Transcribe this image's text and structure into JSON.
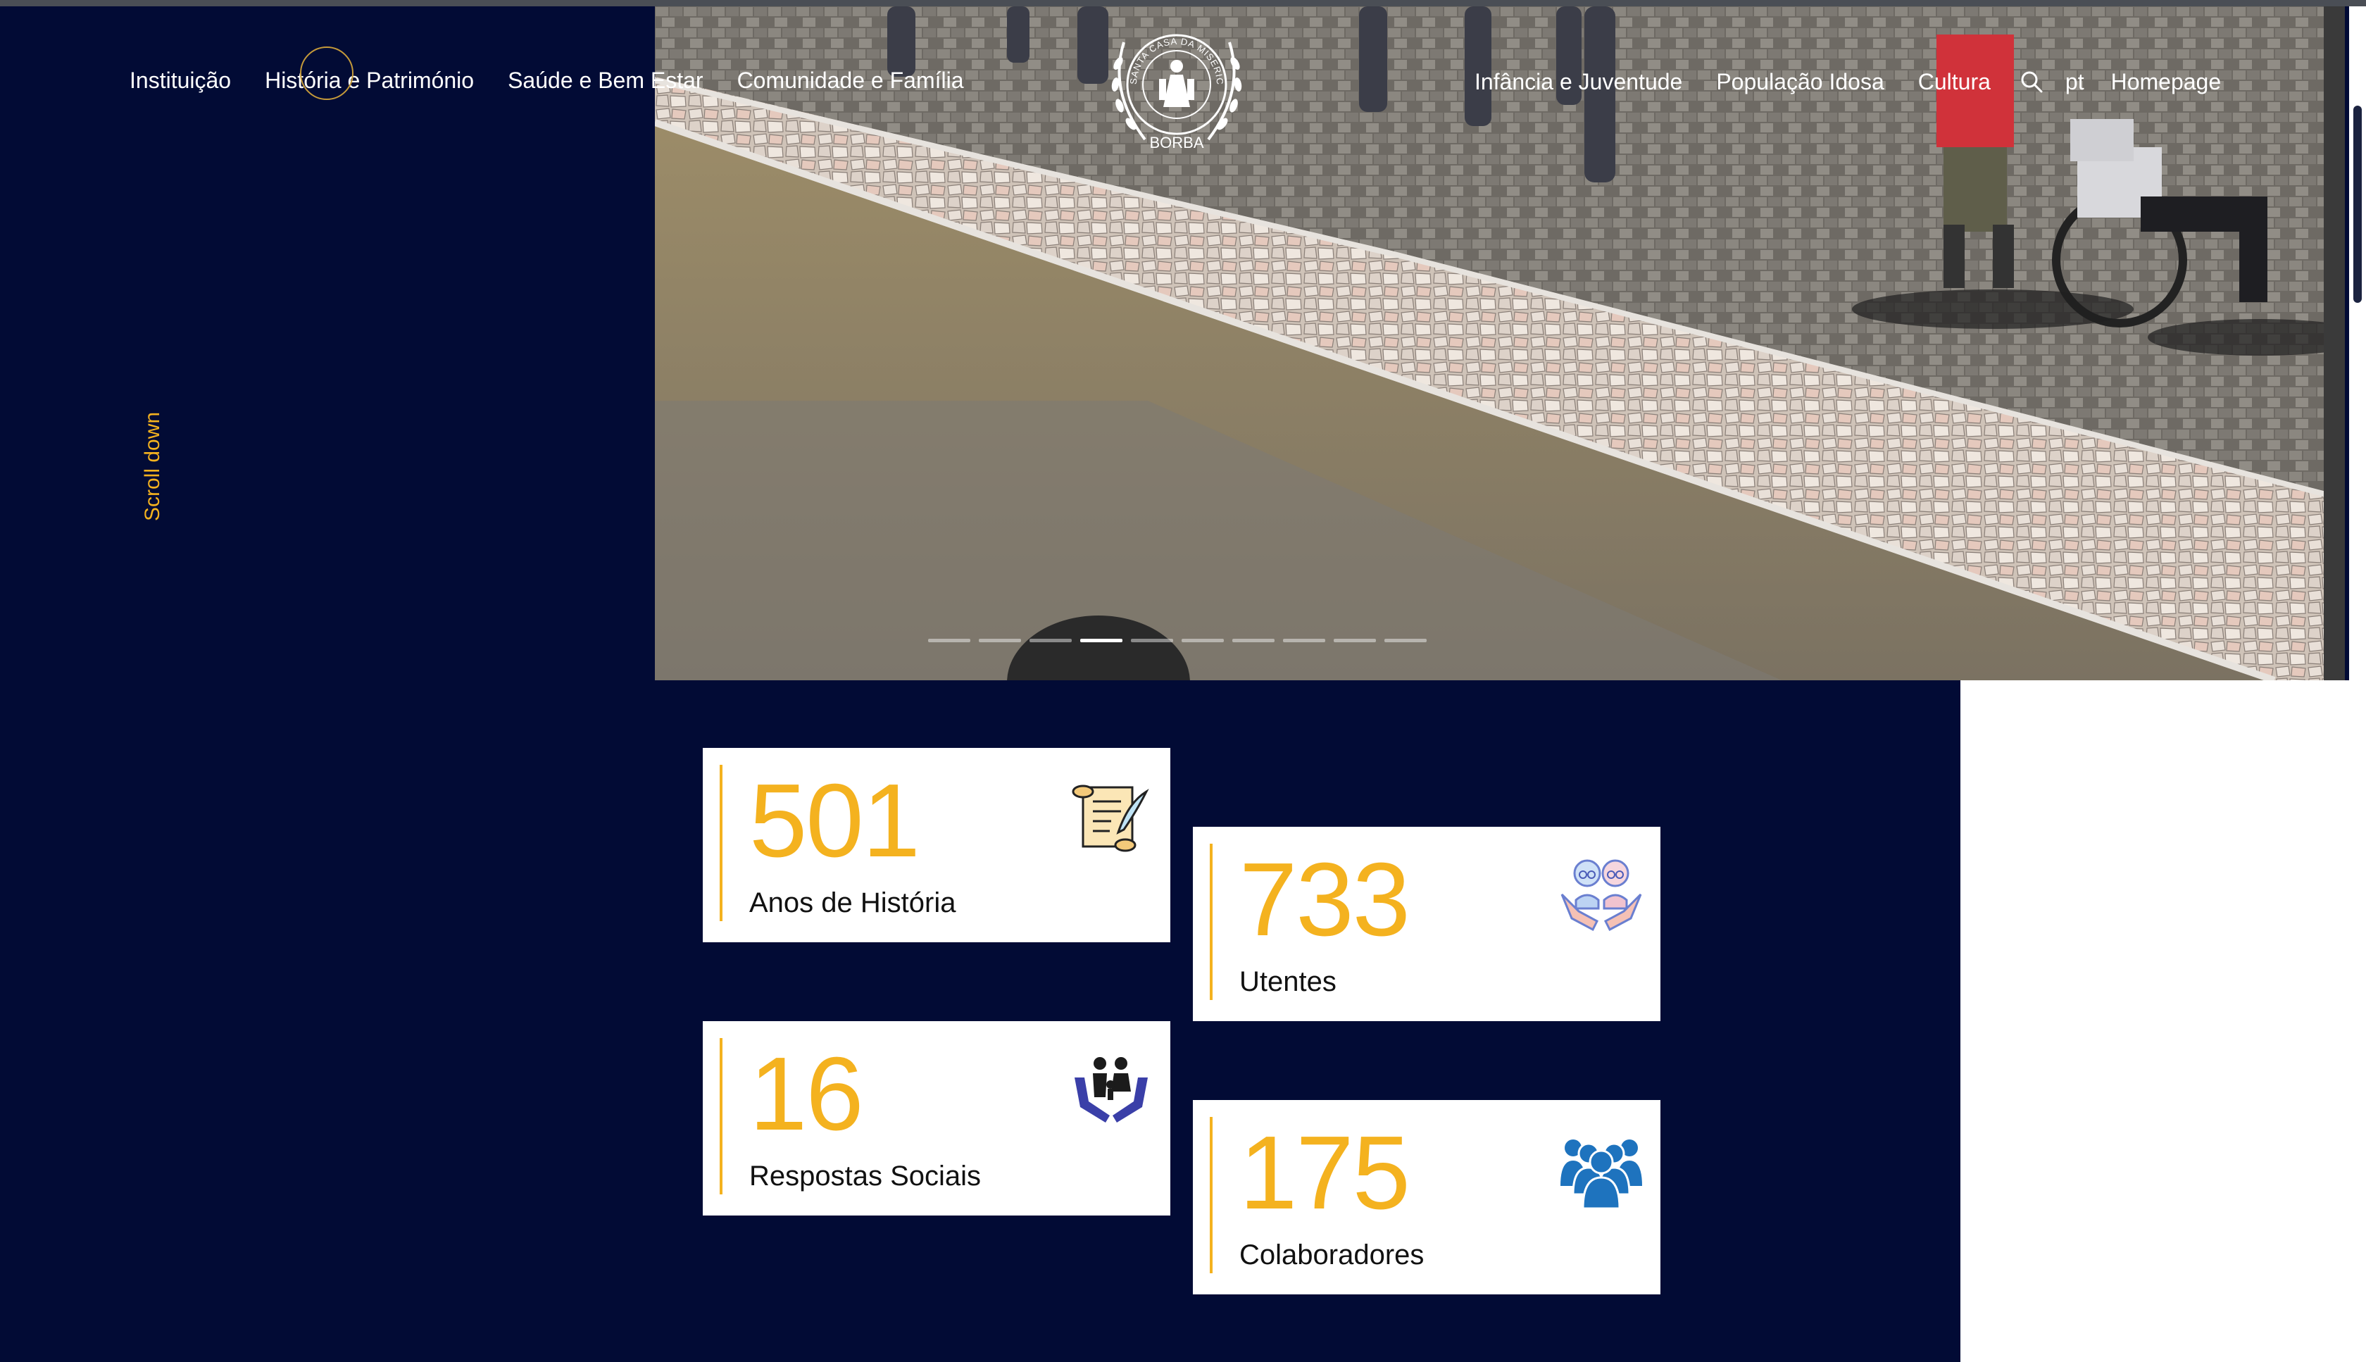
{
  "nav": {
    "left": [
      "Instituição",
      "História e Património",
      "Saúde e Bem Estar",
      "Comunidade e Família"
    ],
    "right": [
      "Infância e Juventude",
      "População Idosa",
      "Cultura"
    ],
    "lang": "pt",
    "homepage": "Homepage"
  },
  "logo": {
    "ring_text": "SANTA CASA DA MISERICÓRDIA",
    "town": "BORBA"
  },
  "hero": {
    "scroll_label": "Scroll down",
    "slides_total": 10,
    "active_slide": 4
  },
  "stats": [
    {
      "value": "501",
      "label": "Anos de História",
      "icon": "scroll-quill-icon"
    },
    {
      "value": "733",
      "label": "Utentes",
      "icon": "elderly-couple-hands-icon"
    },
    {
      "value": "16",
      "label": "Respostas Sociais",
      "icon": "family-hands-icon"
    },
    {
      "value": "175",
      "label": "Colaboradores",
      "icon": "team-people-icon"
    }
  ],
  "colors": {
    "background": "#020b35",
    "accent": "#f4b21f",
    "card": "#ffffff"
  }
}
